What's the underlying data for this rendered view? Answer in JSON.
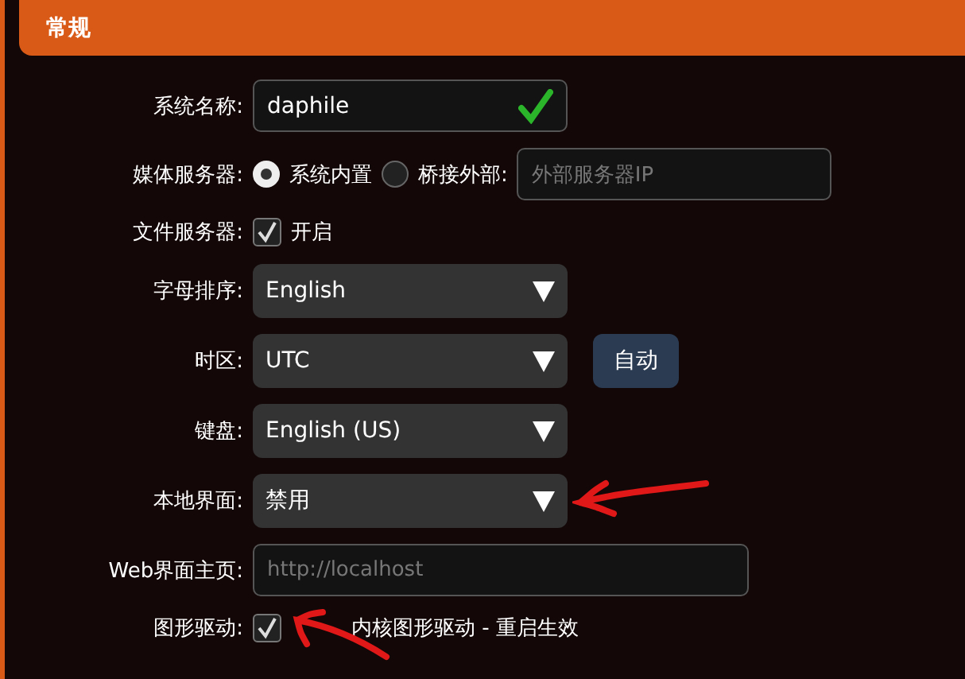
{
  "section": {
    "title": "常规"
  },
  "fields": [
    {
      "kind": "text",
      "label": "系统名称:",
      "value": "daphile",
      "valid": true
    },
    {
      "kind": "radio",
      "label": "媒体服务器:",
      "options": [
        {
          "label": "系统内置",
          "selected": true
        },
        {
          "label": "桥接外部:",
          "selected": false
        }
      ],
      "placeholder": "外部服务器IP"
    },
    {
      "kind": "checkbox",
      "label": "文件服务器:",
      "text": "开启",
      "checked": true
    },
    {
      "kind": "select",
      "label": "字母排序:",
      "value": "English"
    },
    {
      "kind": "select",
      "label": "时区:",
      "value": "UTC",
      "button": "自动"
    },
    {
      "kind": "select",
      "label": "键盘:",
      "value": "English (US)"
    },
    {
      "kind": "select",
      "label": "本地界面:",
      "value": "禁用"
    },
    {
      "kind": "wide_text",
      "label": "Web界面主页:",
      "placeholder": "http://localhost"
    },
    {
      "kind": "checkbox",
      "label": "图形驱动:",
      "text": "内核图形驱动 - 重启生效",
      "checked": true
    }
  ]
}
